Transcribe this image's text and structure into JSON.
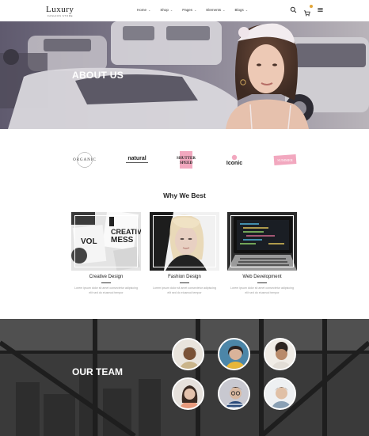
{
  "header": {
    "logo": "Luxury",
    "logo_sub": "FASHION STORE",
    "nav": [
      {
        "label": "Home"
      },
      {
        "label": "Shop"
      },
      {
        "label": "Pages"
      },
      {
        "label": "Elements"
      },
      {
        "label": "Blogs"
      }
    ],
    "icons": [
      "search-icon",
      "cart-icon",
      "menu-icon"
    ]
  },
  "hero": {
    "title": "ABOUT US"
  },
  "brands": {
    "organic": "ORGANIC",
    "natural": "natural",
    "shutter_l1": "SHUTTER",
    "shutter_l2": "SPEED",
    "iconic": "Iconic",
    "summer": "SUMMER"
  },
  "why": {
    "title": "Why We Best",
    "cards": [
      {
        "title": "Creative Design",
        "text_l1": "Lorem ipsum dolor sit amet consectetur adipiscing",
        "text_l2": "elit sed do eiusmod tempor"
      },
      {
        "title": "Fashion Design",
        "text_l1": "Lorem ipsum dolor sit amet consectetur adipiscing",
        "text_l2": "elit sed do eiusmod tempor"
      },
      {
        "title": "Web Development",
        "text_l1": "Lorem ipsum dolor sit amet consectetur adipiscing",
        "text_l2": "elit sed do eiusmod tempor"
      }
    ]
  },
  "team": {
    "title": "OUR TEAM"
  },
  "colors": {
    "accent": "#e2a63a",
    "pink": "#f2a8bf",
    "dark": "#222222"
  }
}
